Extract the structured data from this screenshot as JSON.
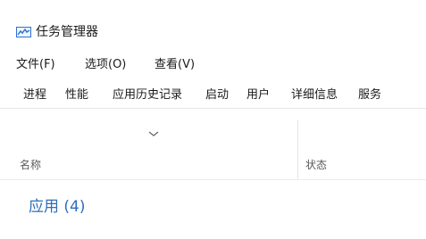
{
  "window": {
    "title": "任务管理器",
    "icon": "task-manager-icon",
    "accent_color": "#2f6ebd"
  },
  "menubar": {
    "items": [
      {
        "label": "文件(F)"
      },
      {
        "label": "选项(O)"
      },
      {
        "label": "查看(V)"
      }
    ]
  },
  "tabs": {
    "active_index": 0,
    "items": [
      {
        "label": "进程"
      },
      {
        "label": "性能"
      },
      {
        "label": "应用历史记录"
      },
      {
        "label": "启动"
      },
      {
        "label": "用户"
      },
      {
        "label": "详细信息"
      },
      {
        "label": "服务"
      }
    ]
  },
  "table": {
    "sort_icon": "chevron-down-icon",
    "columns": [
      {
        "label": "名称"
      },
      {
        "label": "状态"
      }
    ]
  },
  "groups": [
    {
      "label": "应用 (4)"
    }
  ]
}
